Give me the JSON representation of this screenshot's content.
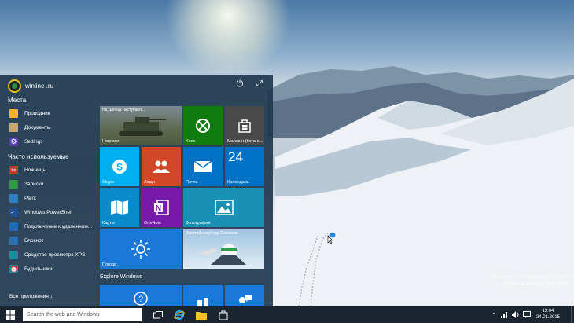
{
  "desktop": {
    "watermark_line1": "Windows 10 Pro Technical Preview",
    "watermark_line2": "Пробная версия. Build 9926"
  },
  "start_menu": {
    "user_name": "winline .ru",
    "places_heading": "Места",
    "places": [
      {
        "label": "Проводник",
        "icon": "folder-icon",
        "color": "#f2b32a"
      },
      {
        "label": "Документы",
        "icon": "documents-icon",
        "color": "#c8a96a"
      },
      {
        "label": "Settings",
        "icon": "gear-icon",
        "color": "#5b3fb3"
      }
    ],
    "frequent_heading": "Часто используемые",
    "frequent": [
      {
        "label": "Ножницы",
        "icon": "scissors-icon",
        "color": "#c0392b"
      },
      {
        "label": "Записки",
        "icon": "sticky-notes-icon",
        "color": "#2e9b45"
      },
      {
        "label": "Paint",
        "icon": "paint-icon",
        "color": "#2f7fc4"
      },
      {
        "label": "Windows PowerShell",
        "icon": "powershell-icon",
        "color": "#1f4f96"
      },
      {
        "label": "Подключение к удаленном...",
        "icon": "remote-desktop-icon",
        "color": "#1e6bb8"
      },
      {
        "label": "Блокнот",
        "icon": "notepad-icon",
        "color": "#2a6fb0"
      },
      {
        "label": "Средство просмотра XPS",
        "icon": "xps-viewer-icon",
        "color": "#1c8c9c"
      },
      {
        "label": "Будильники",
        "icon": "alarms-icon",
        "color": "#1c8c9c"
      }
    ],
    "all_apps_label": "Все приложения  ↓",
    "explore_label": "Explore Windows",
    "tiles": {
      "news": {
        "label": "Новости",
        "headline": "На Донецк наступают...",
        "color": "#4a5a66"
      },
      "xbox": {
        "label": "Xbox",
        "color": "#107c10"
      },
      "store": {
        "label": "Магазин (бета-в...",
        "color": "#4a4a4a"
      },
      "skype": {
        "label": "Skype",
        "color": "#00aff0"
      },
      "people": {
        "label": "Люди",
        "color": "#d24726"
      },
      "mail": {
        "label": "Почта",
        "color": "#0072c6"
      },
      "calendar": {
        "label": "Календарь",
        "day": "24",
        "color": "#0072c6"
      },
      "maps": {
        "label": "Карты",
        "color": "#0a8acb"
      },
      "onenote": {
        "label": "OneNote",
        "color": "#7719aa"
      },
      "photos": {
        "label": "Фотографии",
        "color": "#1a91b4"
      },
      "weather": {
        "label": "Погода",
        "color": "#1a78d8"
      },
      "sport": {
        "headline": "Золотой сноуборд Соболева",
        "color": "#8fb8d8"
      },
      "help": {
        "color": "#1a78d8"
      },
      "windows_feedback": {
        "color": "#1a78d8"
      },
      "feedback": {
        "color": "#1a78d8"
      }
    }
  },
  "taskbar": {
    "search_placeholder": "Search the web and Windows",
    "clock_time": "13:04",
    "clock_date": "24.01.2015"
  }
}
